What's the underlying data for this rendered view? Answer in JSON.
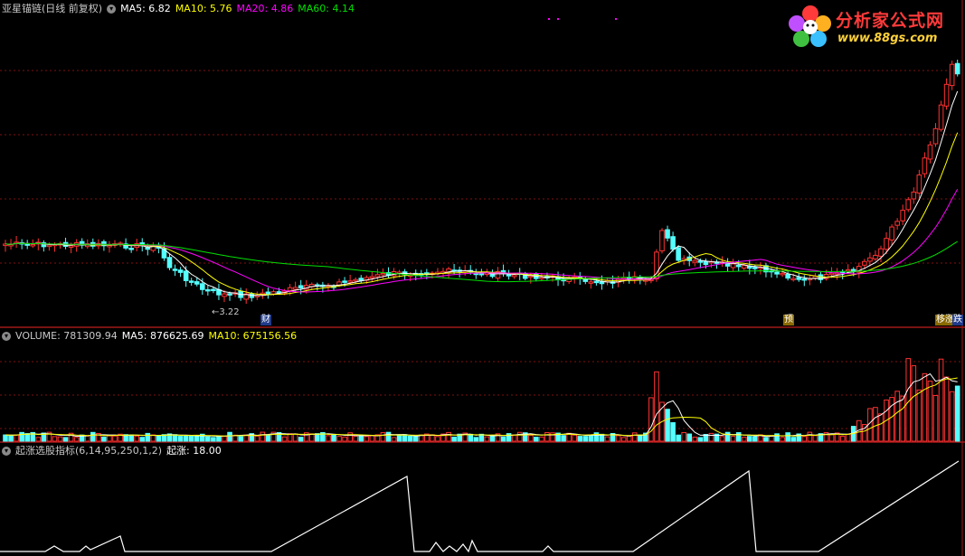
{
  "price_panel": {
    "title": "亚星锚链(日线 前复权)",
    "ma5": "MA5: 6.82",
    "ma10": "MA10: 5.76",
    "ma20": "MA20: 4.86",
    "ma60": "MA60: 4.14",
    "low_annotation": "3.22",
    "tags": {
      "cai": "财",
      "yu": "预",
      "yizhang": "移涨",
      "die": "跌"
    }
  },
  "volume_panel": {
    "volume": "VOLUME: 781309.94",
    "ma5": "MA5: 876625.69",
    "ma10": "MA10: 675156.56"
  },
  "indicator_panel": {
    "name": "起涨选股指标(6,14,95,250,1,2)",
    "value": "起涨: 18.00"
  },
  "logo": {
    "title": "分析家公式网",
    "url": "www.88gs.com"
  },
  "colors": {
    "up": "#ff3232",
    "down": "#54ffff",
    "ma5": "#ffffff",
    "ma10": "#ffff00",
    "ma20": "#ff00ff",
    "ma60": "#00e000",
    "grid": "#801010",
    "indicator": "#ffffff"
  }
}
